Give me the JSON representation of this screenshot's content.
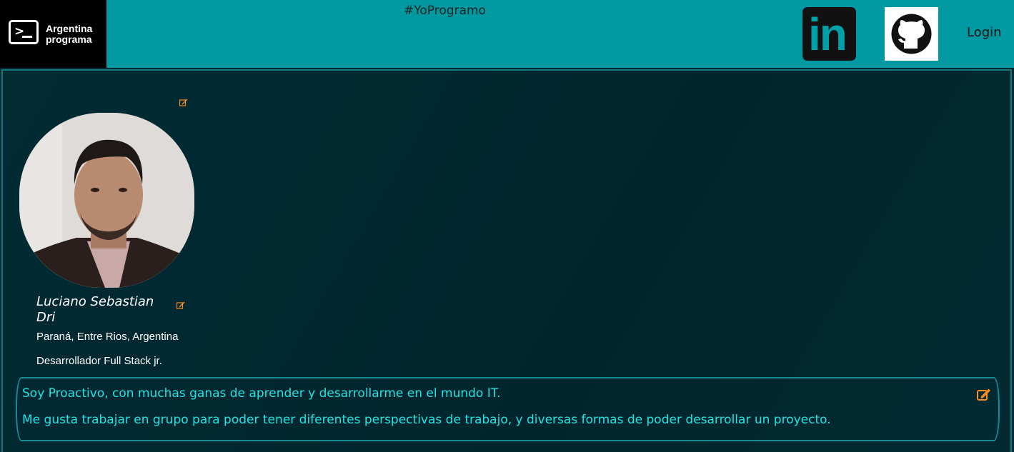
{
  "header": {
    "logo_line1": "Argentina",
    "logo_line2": "programa",
    "hashtag": "#YoProgramo",
    "login_label": "Login",
    "linkedin_text": "in"
  },
  "profile": {
    "name": "Luciano Sebastian Dri",
    "location": "Paraná, Entre Rios, Argentina",
    "role": "Desarrollador Full Stack jr."
  },
  "about": {
    "line1": "Soy Proactivo, con muchas ganas de aprender y desarrollarme en el mundo IT.",
    "line2": "Me gusta trabajar en grupo para poder tener diferentes perspectivas de trabajo, y diversas formas de poder desarrollar un proyecto."
  },
  "colors": {
    "header_bg": "#0099a1",
    "panel_bg": "#012a33",
    "about_text": "#22e3e3",
    "edit_icon": "#ff8c1a"
  },
  "icons": [
    "terminal-logo-icon",
    "linkedin-icon",
    "github-icon",
    "edit-icon"
  ]
}
